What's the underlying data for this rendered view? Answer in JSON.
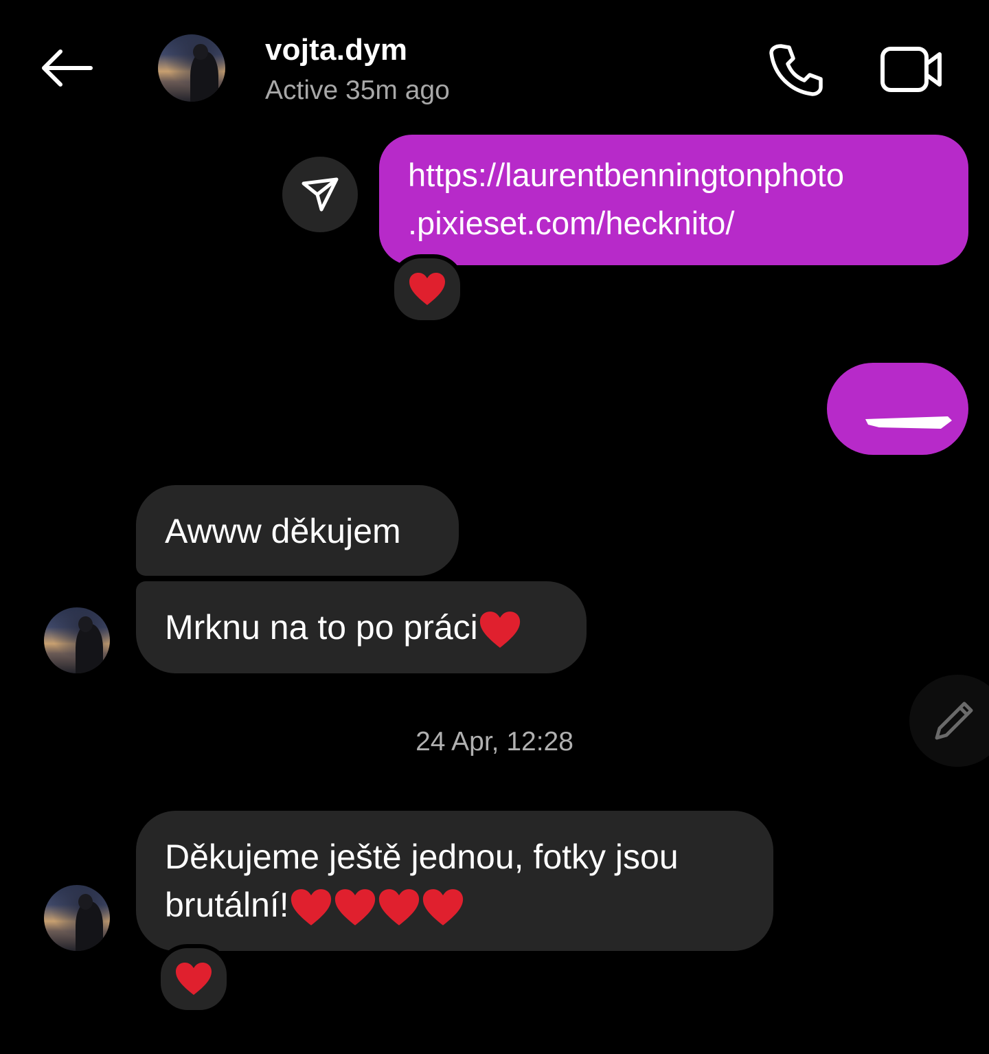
{
  "header": {
    "username": "vojta.dym",
    "status": "Active 35m ago",
    "icons": [
      "arrow-left-icon",
      "phone-icon",
      "video-camera-icon"
    ]
  },
  "messages": {
    "share_link": ".pixieset.com/hecknito/",
    "share_link_line1": "https://laurentbenningtonphoto",
    "share_link_line2": ".pixieset.com/hecknito/",
    "msg1": "Awww děkujem",
    "msg2": "Mrknu na to po práci",
    "msg3_line1": "Děkujeme ještě jednou, fotky jsou",
    "msg3_line2": "brutální!"
  },
  "timestamp": "24 Apr, 12:28",
  "reactions": [
    "❤️",
    "❤️"
  ],
  "colors": {
    "background": "#000000",
    "outgoing_bubble": "#b72ac9",
    "incoming_bubble": "#262626",
    "status_text": "#a8a8a8",
    "heart": "#e0202e"
  }
}
